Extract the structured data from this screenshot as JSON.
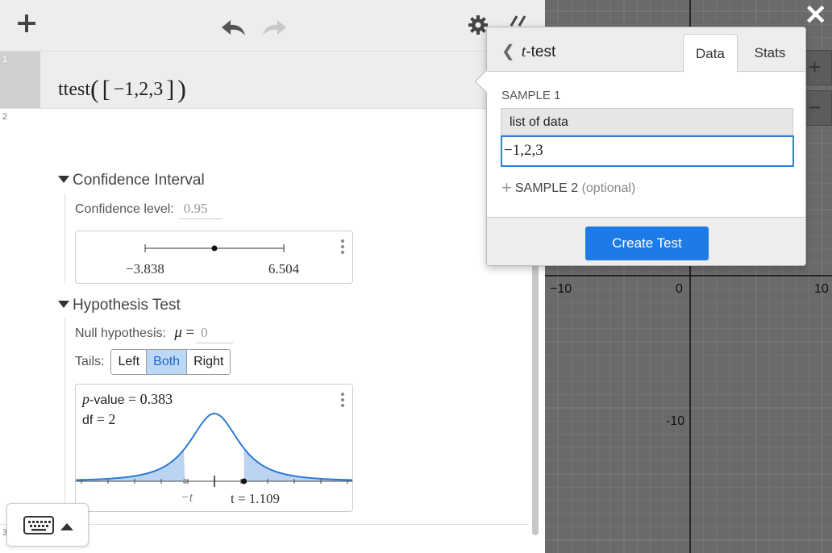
{
  "toolbar": {
    "add_icon": "plus-icon",
    "undo_icon": "undo-icon",
    "redo_icon": "redo-icon",
    "settings_icon": "gear-icon",
    "collapse_icon": "double-chevron-left-icon"
  },
  "expressions": [
    {
      "index": "1"
    },
    {
      "index": "2"
    },
    {
      "index": "3"
    }
  ],
  "ttest": {
    "func": "ttest",
    "list": "−1,2,3",
    "confidence": {
      "heading": "Confidence Interval",
      "level_label": "Confidence level:",
      "level_value": "0.95",
      "low": "−3.838",
      "high": "6.504",
      "low_value": -3.838,
      "high_value": 6.504,
      "mean_value": 1.333
    },
    "hypothesis": {
      "heading": "Hypothesis Test",
      "null_label": "Null hypothesis:",
      "mu_symbol": "μ",
      "eq": "=",
      "null_value": "0",
      "tails_label": "Tails:",
      "tails": [
        "Left",
        "Both",
        "Right"
      ],
      "selected_tail": "Both",
      "p_label": "p",
      "p_suffix": "-value",
      "p_value": "0.383",
      "df_label": "df",
      "df_value": "2",
      "neg_t_label": "−t",
      "t_label": "t = 1.109",
      "t_stat": 1.109
    }
  },
  "graph": {
    "x_ticks": [
      "−10",
      "0",
      "10"
    ],
    "y_ticks": [
      "-10"
    ],
    "close_icon": "close-icon",
    "zoom_in": "+",
    "zoom_out": "−"
  },
  "popover": {
    "back_icon": "chevron-left-icon",
    "title_t": "t",
    "title_rest": "-test",
    "tabs": [
      "Data",
      "Stats"
    ],
    "active_tab": "Data",
    "sample1_label": "SAMPLE 1",
    "column_header": "list of data",
    "input_value": "−1,2,3",
    "sample2_label": "SAMPLE 2",
    "sample2_optional": "(optional)",
    "create_button": "Create Test"
  },
  "keyboard": {
    "icon": "keyboard-icon",
    "arrow_icon": "triangle-up-icon"
  },
  "colors": {
    "accent": "#1d7be8",
    "curve": "#2a7ad6",
    "tail_fill": "#bcd4f2",
    "graph_bg": "#6a6a6a",
    "grid_minor": "#757575",
    "grid_major": "#7e7e7e"
  }
}
